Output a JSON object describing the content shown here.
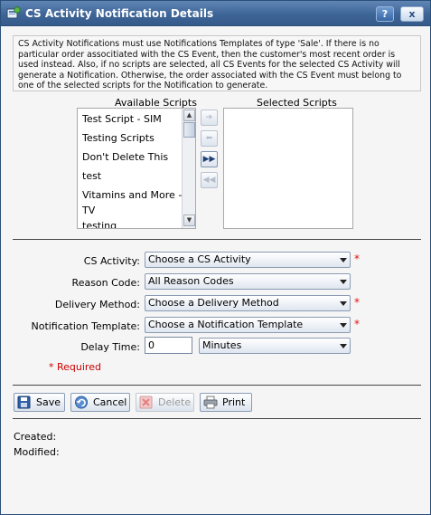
{
  "window": {
    "title": "CS Activity Notification Details",
    "help_label": "?",
    "close_label": "x"
  },
  "info_text": "CS Activity Notifications must use Notifications Templates of type 'Sale'. If there is no particular order associtiated with the CS Event, then the customer's most recent order is used instead. Also, if no scripts are selected, all CS Events for the selected CS Activity will generate a Notification. Otherwise, the order associated with the CS Event must belong to one of the selected scripts for the Notification to generate.",
  "scripts": {
    "available_header": "Available Scripts",
    "selected_header": "Selected Scripts",
    "available": [
      "Test Script - SIM",
      "Testing Scripts",
      "Don't Delete This",
      "test",
      "Vitamins and More -",
      "TV",
      "testing"
    ],
    "selected": []
  },
  "form": {
    "cs_activity": {
      "label": "CS Activity:",
      "value": "Choose a CS Activity",
      "required": true
    },
    "reason_code": {
      "label": "Reason Code:",
      "value": "All Reason Codes",
      "required": false
    },
    "delivery_method": {
      "label": "Delivery Method:",
      "value": "Choose a Delivery Method",
      "required": true
    },
    "notification_template": {
      "label": "Notification Template:",
      "value": "Choose a Notification Template",
      "required": true
    },
    "delay_time": {
      "label": "Delay Time:",
      "value": "0",
      "unit": "Minutes"
    },
    "required_star": "*",
    "required_note": "* Required"
  },
  "toolbar": {
    "save": "Save",
    "cancel": "Cancel",
    "delete": "Delete",
    "print": "Print"
  },
  "meta": {
    "created_label": "Created:",
    "modified_label": "Modified:"
  }
}
